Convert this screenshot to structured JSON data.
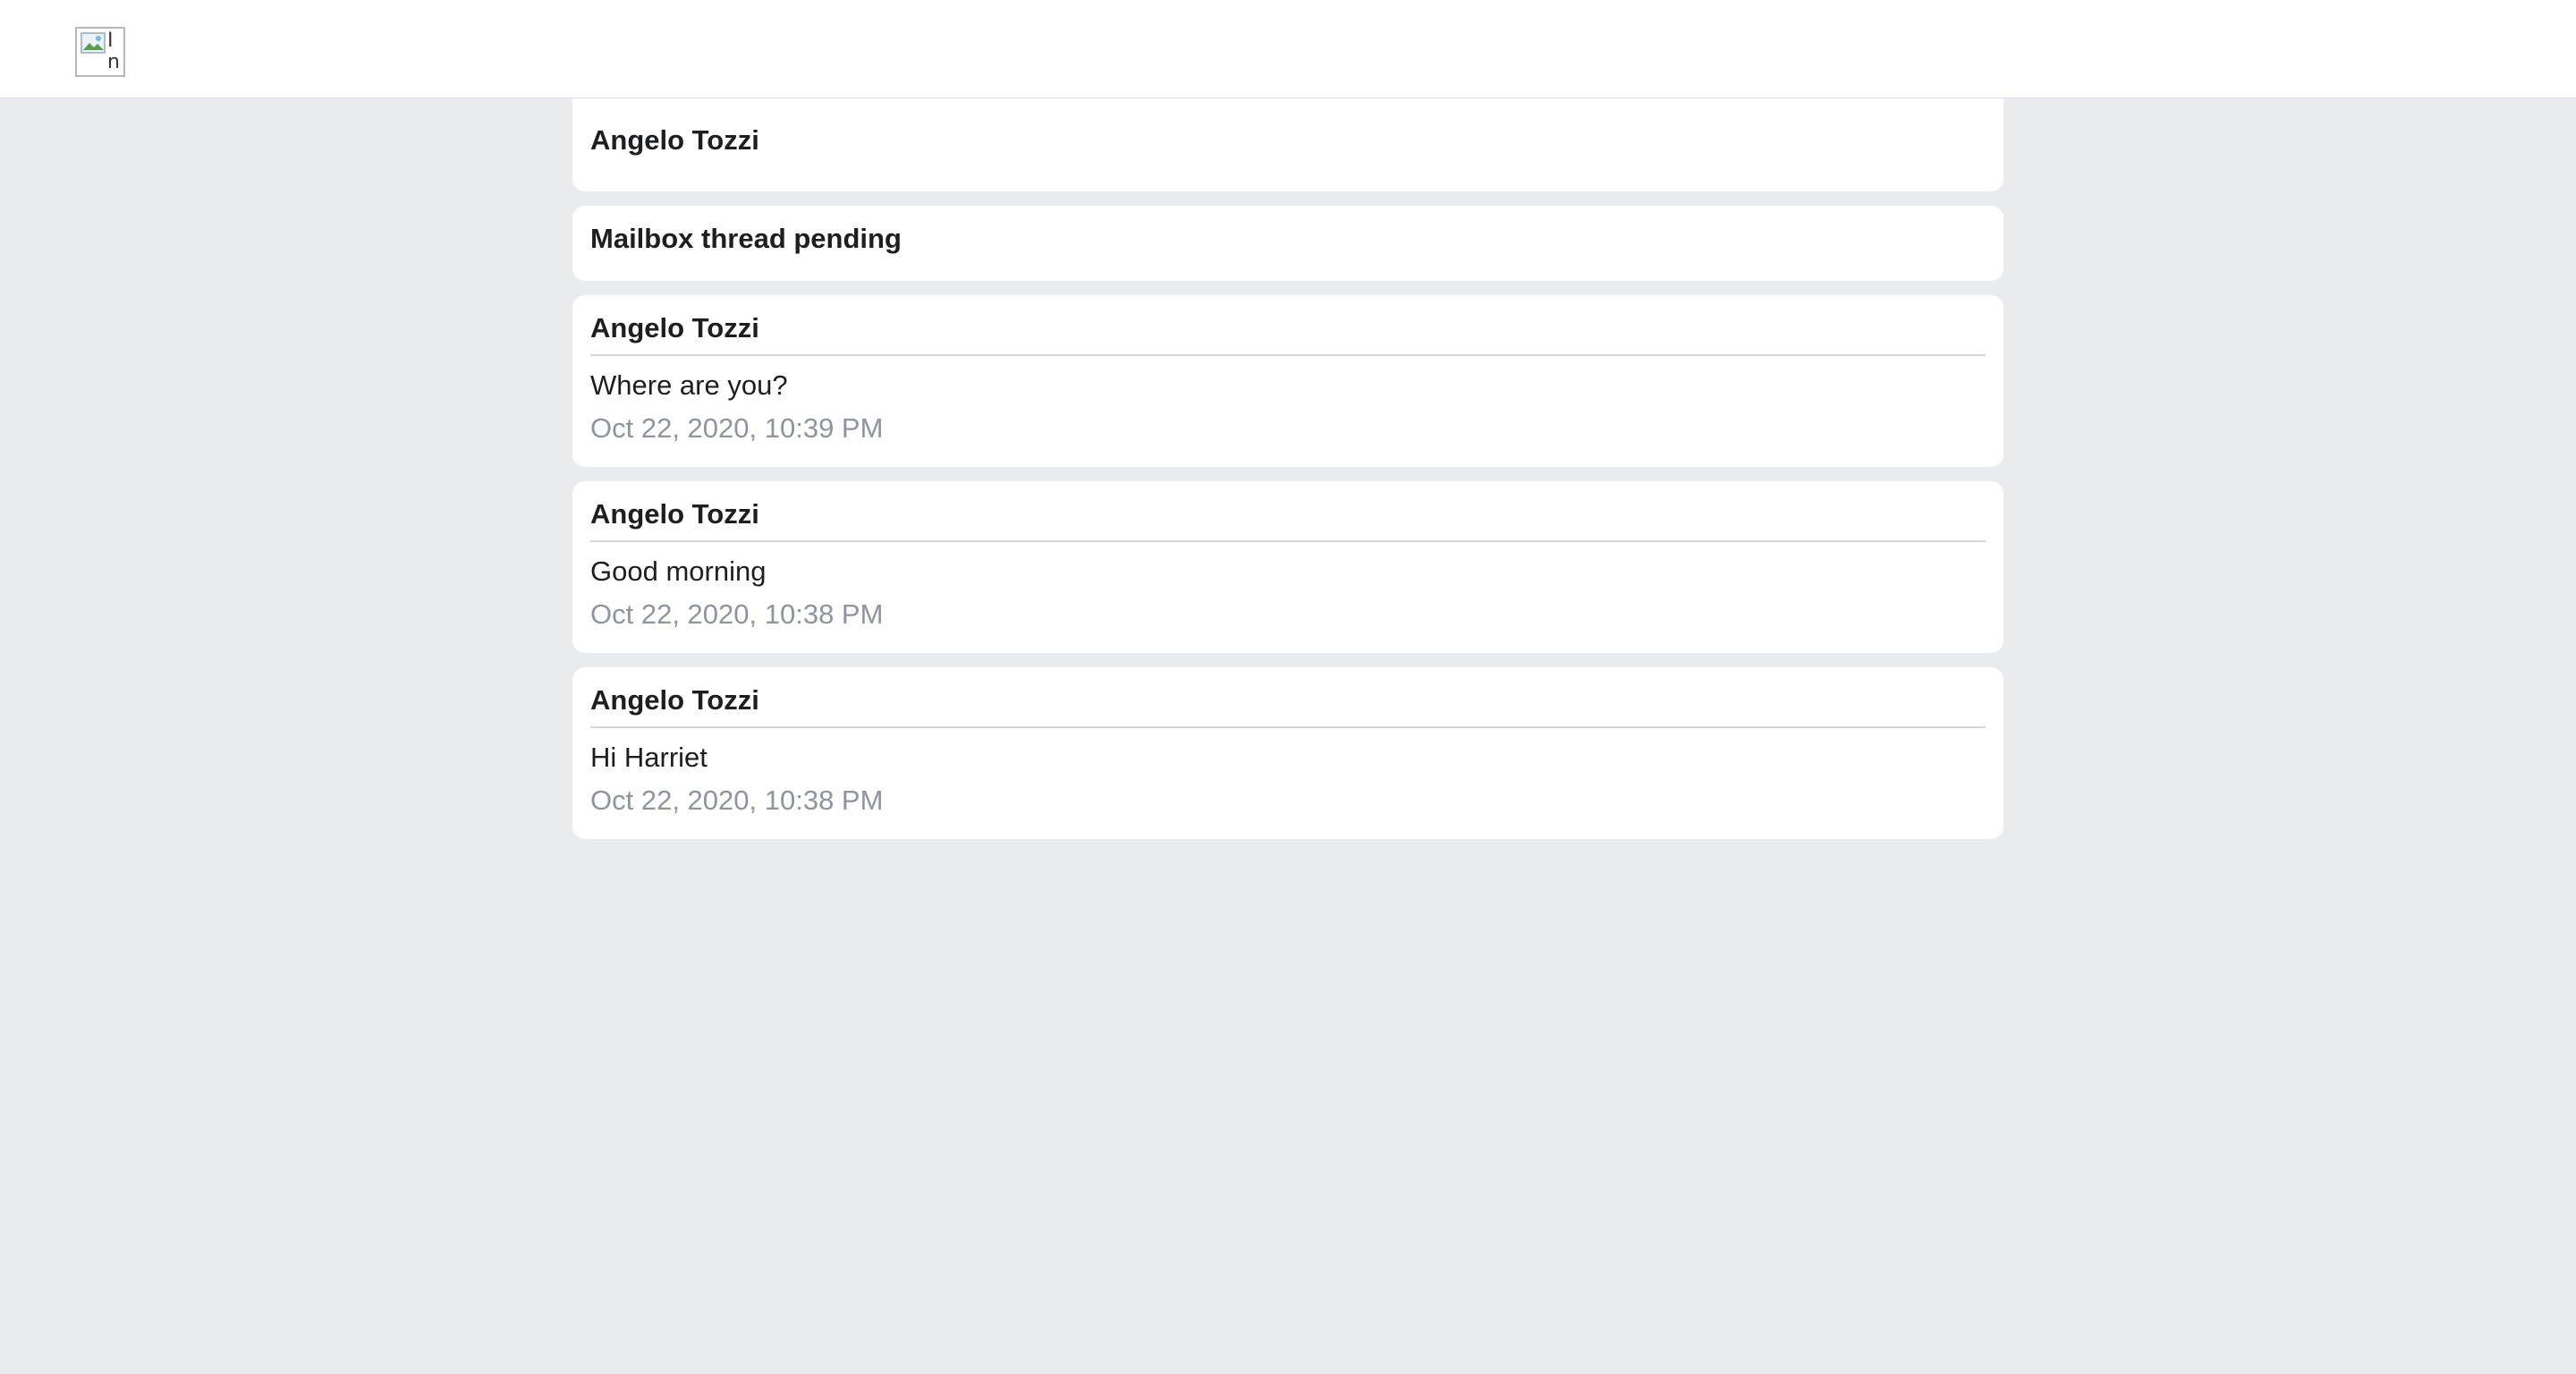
{
  "header": {
    "logo_alt": "In",
    "logo_icon": "broken-image-icon"
  },
  "contact": {
    "name": "Angelo Tozzi"
  },
  "pending_notice": "Mailbox thread pending",
  "messages": [
    {
      "sender": "Angelo Tozzi",
      "text": "Where are you?",
      "time": "Oct 22, 2020, 10:39 PM"
    },
    {
      "sender": "Angelo Tozzi",
      "text": "Good morning",
      "time": "Oct 22, 2020, 10:38 PM"
    },
    {
      "sender": "Angelo Tozzi",
      "text": "Hi Harriet",
      "time": "Oct 22, 2020, 10:38 PM"
    }
  ],
  "colors": {
    "background": "#e9ebee",
    "card": "#ffffff",
    "text": "#1c1e21",
    "muted": "#90949c",
    "divider": "#d6d7da"
  }
}
